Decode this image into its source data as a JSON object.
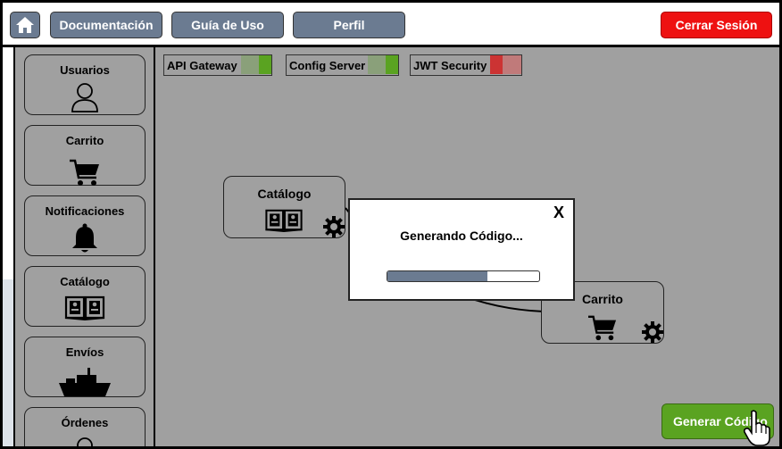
{
  "header": {
    "home_icon": "home-icon",
    "buttons": [
      "Documentación",
      "Guía de Uso",
      "Perfil"
    ],
    "logout_label": "Cerrar Sesión"
  },
  "sidebar": {
    "items": [
      {
        "label": "Usuarios",
        "icon": "user-icon"
      },
      {
        "label": "Carrito",
        "icon": "cart-icon"
      },
      {
        "label": "Notificaciones",
        "icon": "bell-icon"
      },
      {
        "label": "Catálogo",
        "icon": "book-icon"
      },
      {
        "label": "Envíos",
        "icon": "ship-icon"
      },
      {
        "label": "Órdenes",
        "icon": "user-icon"
      }
    ]
  },
  "services": [
    {
      "label": "API Gateway",
      "status": "ok",
      "color": "#5aa321"
    },
    {
      "label": "Config Server",
      "status": "ok",
      "color": "#5aa321"
    },
    {
      "label": "JWT Security",
      "status": "error",
      "color": "#cc3333"
    }
  ],
  "nodes": [
    {
      "label": "Catálogo",
      "icon": "book-icon",
      "gear": "gear-icon"
    },
    {
      "label": "Carrito",
      "icon": "cart-icon",
      "gear": "gear-icon"
    }
  ],
  "modal": {
    "close_label": "X",
    "message": "Generando Código...",
    "progress": 0.66
  },
  "generate_button": "Generar Código",
  "colors": {
    "primary_button": "#6b7b91",
    "danger": "#ee1111",
    "success": "#5aa321",
    "canvas": "#a0a0a0"
  }
}
